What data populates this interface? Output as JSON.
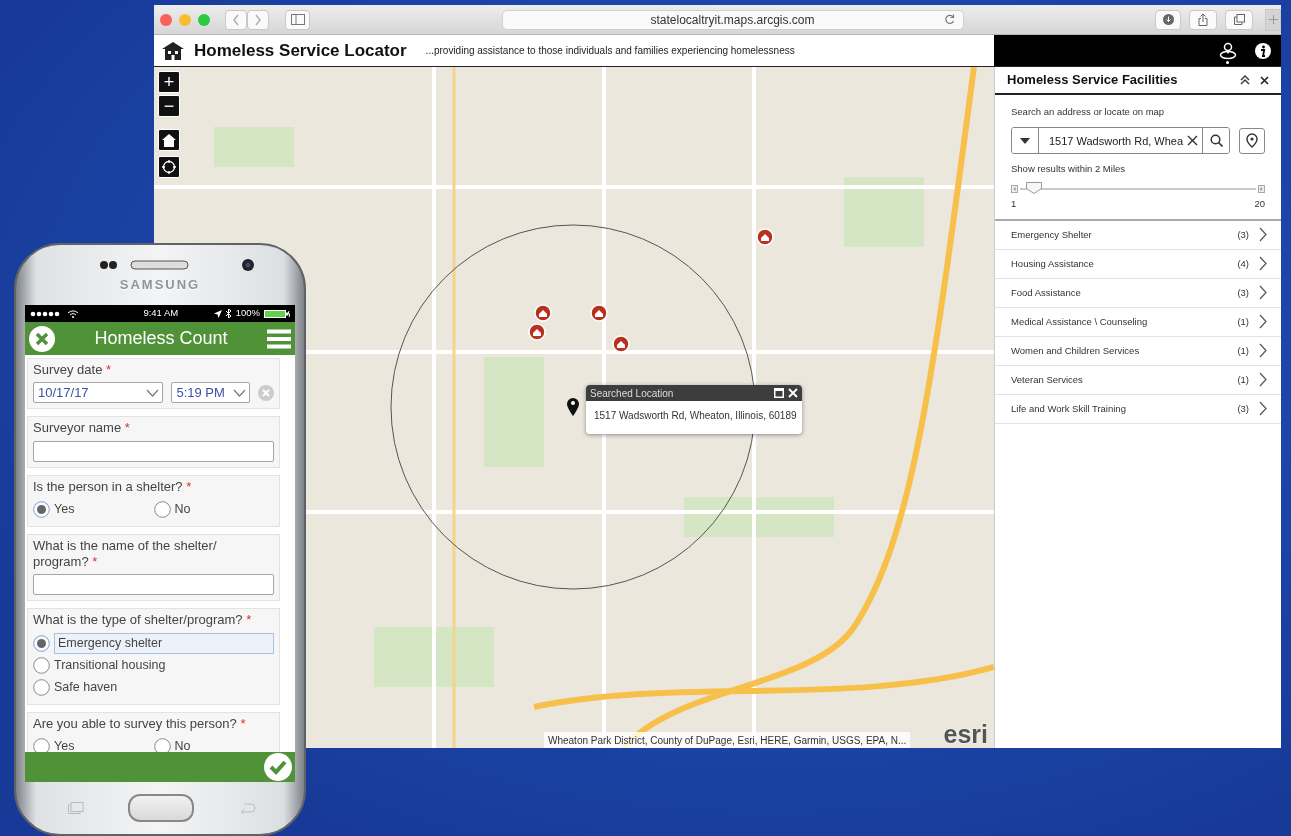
{
  "browser": {
    "url": "statelocaltryit.maps.arcgis.com"
  },
  "app": {
    "title": "Homeless Service Locator",
    "subtitle": "...providing assistance to those individuals and families experiencing homelessness"
  },
  "map": {
    "zoom_in": "+",
    "zoom_out": "−",
    "popup": {
      "title": "Searched Location",
      "text": "1517 Wadsworth Rd, Wheaton, Illinois, 60189"
    },
    "attribution": "Wheaton Park District, County of DuPage, Esri, HERE, Garmin, USGS, EPA, N...",
    "logo": "esri"
  },
  "panel": {
    "title": "Homeless Service Facilities",
    "search_label": "Search an address or locate on map",
    "search_value": "1517 Wadsworth Rd, Whea",
    "radius_label": "Show results within 2 Miles",
    "slider": {
      "level": 0.06,
      "min": "1",
      "max": "20"
    },
    "categories": [
      {
        "name": "Emergency Shelter",
        "count": "(3)"
      },
      {
        "name": "Housing Assistance",
        "count": "(4)"
      },
      {
        "name": "Food Assistance",
        "count": "(3)"
      },
      {
        "name": "Medical Assistance \\ Counseling",
        "count": "(1)"
      },
      {
        "name": "Women and Children Services",
        "count": "(1)"
      },
      {
        "name": "Veteran Services",
        "count": "(1)"
      },
      {
        "name": "Life and Work Skill Training",
        "count": "(3)"
      }
    ]
  },
  "phone": {
    "brand": "SAMSUNG",
    "time": "9:41 AM",
    "battery": "100%",
    "title": "Homeless Count",
    "questions": [
      {
        "kind": "datetime",
        "label": "Survey date",
        "mark": "*",
        "date": "10/17/17",
        "time": "5:19 PM"
      },
      {
        "kind": "text",
        "label": "Surveyor name",
        "mark": "*"
      },
      {
        "kind": "radio",
        "label": "Is the person in a shelter?",
        "mark": "*",
        "inline": true,
        "options": [
          {
            "label": "Yes",
            "selected": true,
            "focused": false
          },
          {
            "label": "No",
            "selected": false,
            "focused": false
          }
        ]
      },
      {
        "kind": "text",
        "label": "What is the name of the shelter/ program?",
        "mark": "*"
      },
      {
        "kind": "radio",
        "label": "What is the type of shelter/program?",
        "mark": "*",
        "inline": false,
        "options": [
          {
            "label": "Emergency shelter",
            "selected": true,
            "focused": true
          },
          {
            "label": "Transitional housing",
            "selected": false,
            "focused": false
          },
          {
            "label": "Safe haven",
            "selected": false,
            "focused": false
          }
        ]
      },
      {
        "kind": "radio",
        "label": "Are you able to survey this person?",
        "mark": "*",
        "inline": true,
        "options": [
          {
            "label": "Yes",
            "selected": false,
            "focused": false
          },
          {
            "label": "No",
            "selected": false,
            "focused": false
          }
        ]
      }
    ]
  }
}
